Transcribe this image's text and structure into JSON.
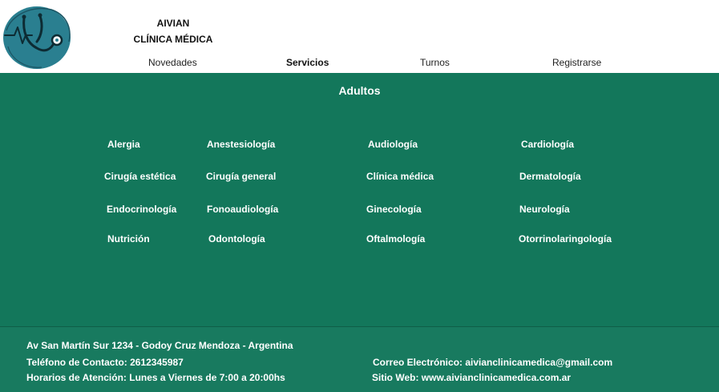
{
  "brand": {
    "line1": "AIVIAN",
    "line2": "CLÍNICA MÉDICA"
  },
  "nav": {
    "items": [
      {
        "label": "Novedades"
      },
      {
        "label": "Servicios"
      },
      {
        "label": "Turnos"
      },
      {
        "label": "Registrarse"
      }
    ]
  },
  "main": {
    "title": "Adultos",
    "services": [
      "Alergia",
      "Anestesiología",
      "Audiología",
      "Cardiología",
      "Cirugía estética",
      "Cirugía general",
      "Clínica médica",
      "Dermatología",
      "Endocrinología",
      "Fonoaudiología",
      "Ginecología",
      "Neurología",
      "Nutrición",
      "Odontología",
      "Oftalmología",
      "Otorrinolaringología"
    ]
  },
  "footer": {
    "address": "Av  San Martín Sur 1234 - Godoy Cruz  Mendoza - Argentina",
    "phone": "Teléfono de Contacto: 2612345987",
    "hours": "Horarios de Atención:  Lunes a Viernes de 7:00 a 20:00hs",
    "email": "Correo Electrónico: aivianclinicamedica@gmail.com",
    "website": "Sitio Web: www.aivianclinicamedica.com.ar"
  },
  "colors": {
    "primary": "#13775b",
    "footer": "#187a5f",
    "logo": "#2a7f90"
  },
  "icons": {
    "logo": "stethoscope-icon"
  }
}
